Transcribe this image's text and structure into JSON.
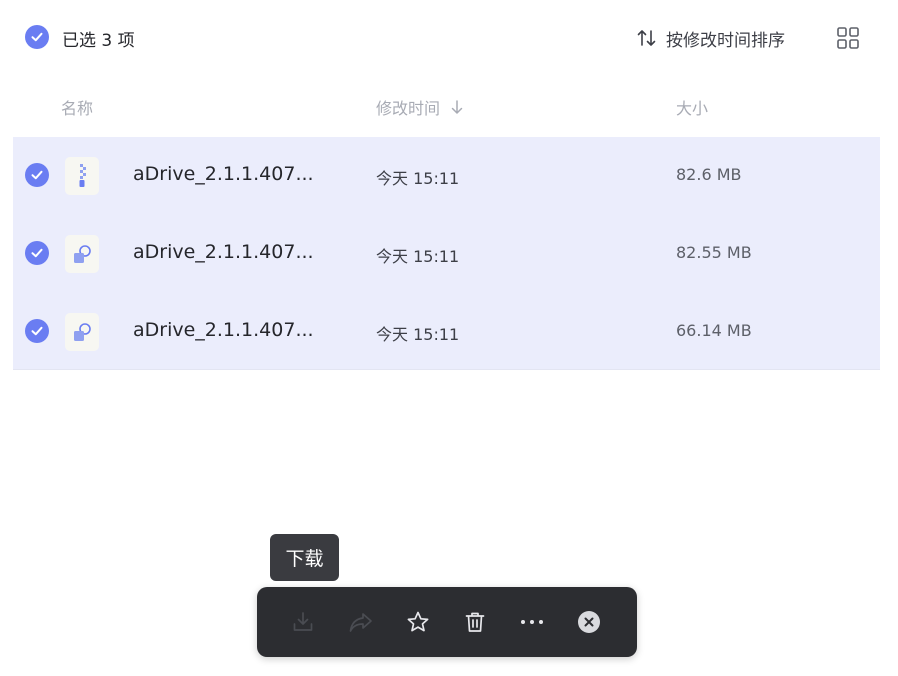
{
  "header": {
    "selected_label": "已选 3 项",
    "sort_label": "按修改时间排序"
  },
  "columns": {
    "name": "名称",
    "modified": "修改时间",
    "size": "大小"
  },
  "files": [
    {
      "name": "aDrive_2.1.1.407...",
      "modified": "今天 15:11",
      "size": "82.6 MB",
      "icon": "zip-file-icon",
      "selected": true
    },
    {
      "name": "aDrive_2.1.1.407...",
      "modified": "今天 15:11",
      "size": "82.55 MB",
      "icon": "installer-file-icon",
      "selected": true
    },
    {
      "name": "aDrive_2.1.1.407...",
      "modified": "今天 15:11",
      "size": "66.14 MB",
      "icon": "installer-file-icon",
      "selected": true
    }
  ],
  "tooltip": {
    "text": "下载"
  },
  "toolbar": {
    "actions": [
      "download-icon",
      "share-icon",
      "star-icon",
      "trash-icon",
      "more-icon",
      "close-icon"
    ]
  },
  "colors": {
    "accent": "#6a7df2",
    "selected_row_bg": "#ebedfc",
    "toolbar_bg": "#2c2d31"
  }
}
